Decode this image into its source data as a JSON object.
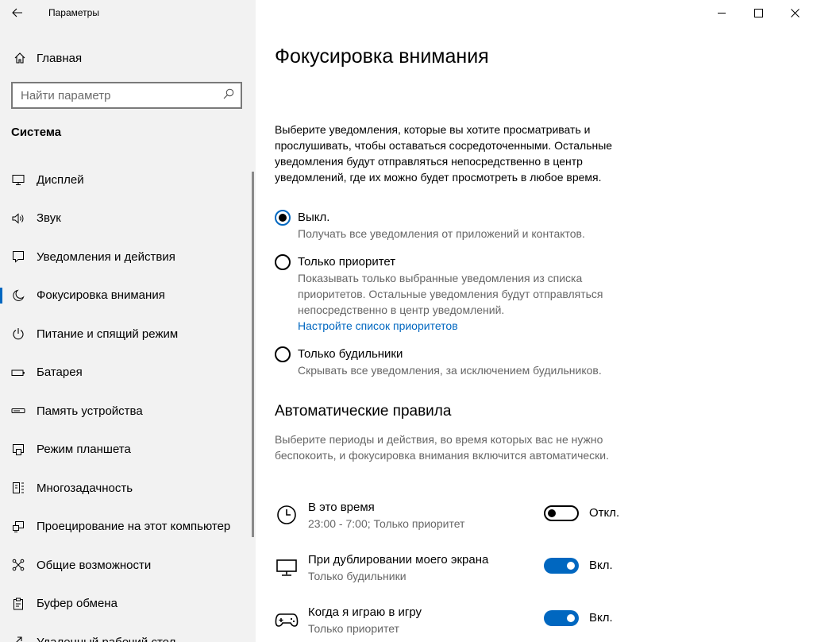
{
  "window": {
    "app_title": "Параметры",
    "minimize_glyph": "—",
    "maximize_glyph": "☐",
    "close_glyph": "✕"
  },
  "sidebar": {
    "home_label": "Главная",
    "search_placeholder": "Найти параметр",
    "section_title": "Система",
    "items": [
      {
        "label": "Дисплей",
        "icon": "monitor-icon"
      },
      {
        "label": "Звук",
        "icon": "speaker-icon"
      },
      {
        "label": "Уведомления и действия",
        "icon": "notification-icon"
      },
      {
        "label": "Фокусировка внимания",
        "icon": "moon-icon",
        "active": true
      },
      {
        "label": "Питание и спящий режим",
        "icon": "power-icon"
      },
      {
        "label": "Батарея",
        "icon": "battery-icon"
      },
      {
        "label": "Память устройства",
        "icon": "storage-icon"
      },
      {
        "label": "Режим планшета",
        "icon": "tablet-icon"
      },
      {
        "label": "Многозадачность",
        "icon": "multitask-icon"
      },
      {
        "label": "Проецирование на этот компьютер",
        "icon": "project-icon"
      },
      {
        "label": "Общие возможности",
        "icon": "shared-icon"
      },
      {
        "label": "Буфер обмена",
        "icon": "clipboard-icon"
      },
      {
        "label": "Удаленный рабочий стол",
        "icon": "remote-icon"
      }
    ]
  },
  "main": {
    "title": "Фокусировка внимания",
    "description": "Выберите уведомления, которые вы хотите просматривать и прослушивать, чтобы оставаться сосредоточенными. Остальные уведомления будут отправляться непосредственно в центр уведомлений, где их можно будет просмотреть в любое время.",
    "options": [
      {
        "label": "Выкл.",
        "desc": "Получать все уведомления от приложений и контактов.",
        "selected": true
      },
      {
        "label": "Только приоритет",
        "desc": "Показывать только выбранные уведомления из списка приоритетов. Остальные уведомления будут отправляться непосредственно в центр уведомлений.",
        "link": "Настройте список приоритетов",
        "selected": false
      },
      {
        "label": "Только будильники",
        "desc": "Скрывать все уведомления, за исключением будильников.",
        "selected": false
      }
    ],
    "rules_title": "Автоматические правила",
    "rules_desc": "Выберите периоды и действия, во время которых вас не нужно беспокоить, и фокусировка внимания включится автоматически.",
    "rules": [
      {
        "name": "В это время",
        "sub": "23:00 - 7:00; Только приоритет",
        "state": "Откл.",
        "on": false,
        "icon": "clock-icon"
      },
      {
        "name": "При дублировании моего экрана",
        "sub": "Только будильники",
        "state": "Вкл.",
        "on": true,
        "icon": "display-icon"
      },
      {
        "name": "Когда я играю в игру",
        "sub": "Только приоритет",
        "state": "Вкл.",
        "on": true,
        "icon": "gamepad-icon"
      }
    ]
  },
  "colors": {
    "accent": "#0067c0",
    "sidebar_bg": "#f2f2f2",
    "secondary_text": "#666666"
  }
}
